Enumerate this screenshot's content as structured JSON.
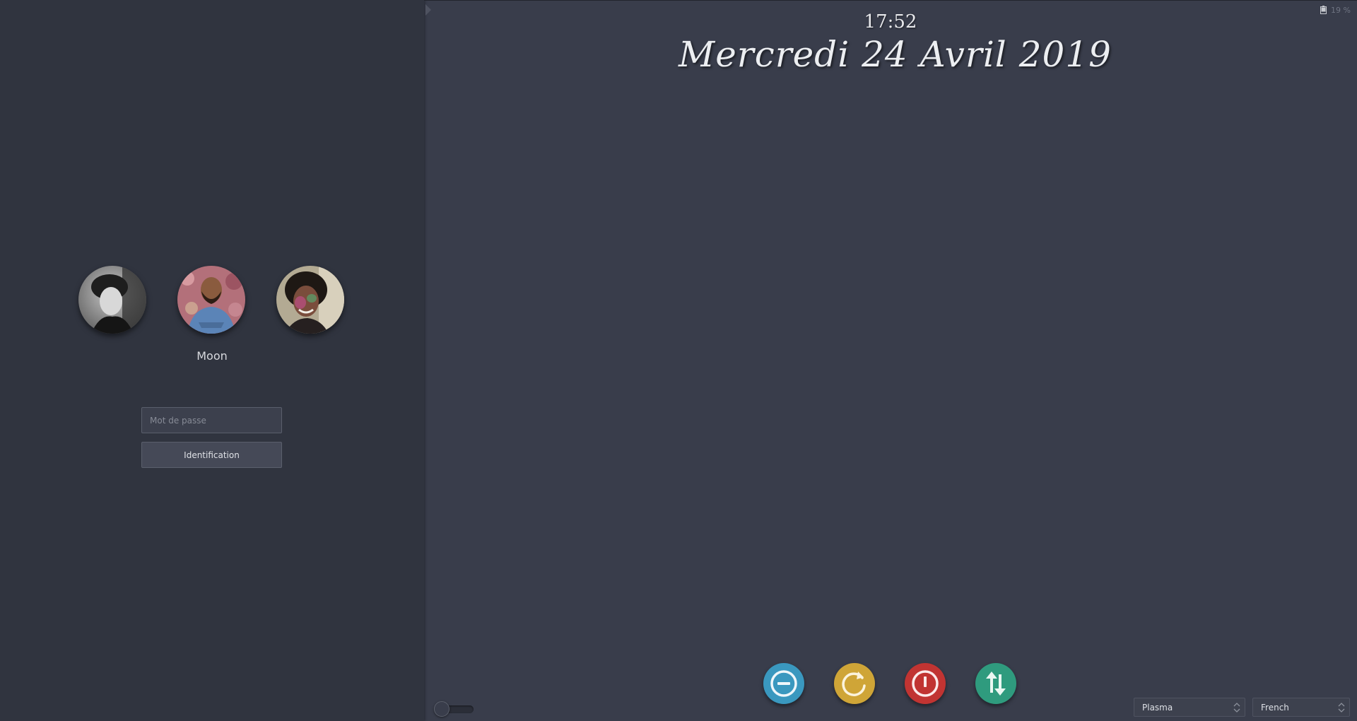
{
  "clock": {
    "time": "17:52"
  },
  "date": {
    "text": "Mercredi 24 Avril 2019"
  },
  "battery": {
    "percent_label": "19 %",
    "icon": "battery-icon"
  },
  "users": [
    {
      "avatar_icon": "user-avatar-1",
      "style": "grayscale portrait"
    },
    {
      "avatar_icon": "user-avatar-2",
      "style": "man with blue shirt, floral background"
    },
    {
      "avatar_icon": "user-avatar-3",
      "style": "woman with colored face paint"
    }
  ],
  "login": {
    "selected_username": "Moon",
    "password_placeholder": "Mot de passe",
    "password_value": "",
    "login_label": "Identification"
  },
  "power": {
    "suspend_icon": "suspend-icon",
    "reboot_icon": "reboot-icon",
    "shutdown_icon": "shutdown-icon",
    "switch_user_icon": "switch-user-icon"
  },
  "bottom_bar": {
    "session": "Plasma",
    "language": "French"
  },
  "colors": {
    "background": "#393d4b",
    "side_panel": "#30343f",
    "suspend": "#3a98bf",
    "reboot": "#cfa537",
    "shutdown": "#c13432",
    "switch_user": "#2f9b7e"
  }
}
